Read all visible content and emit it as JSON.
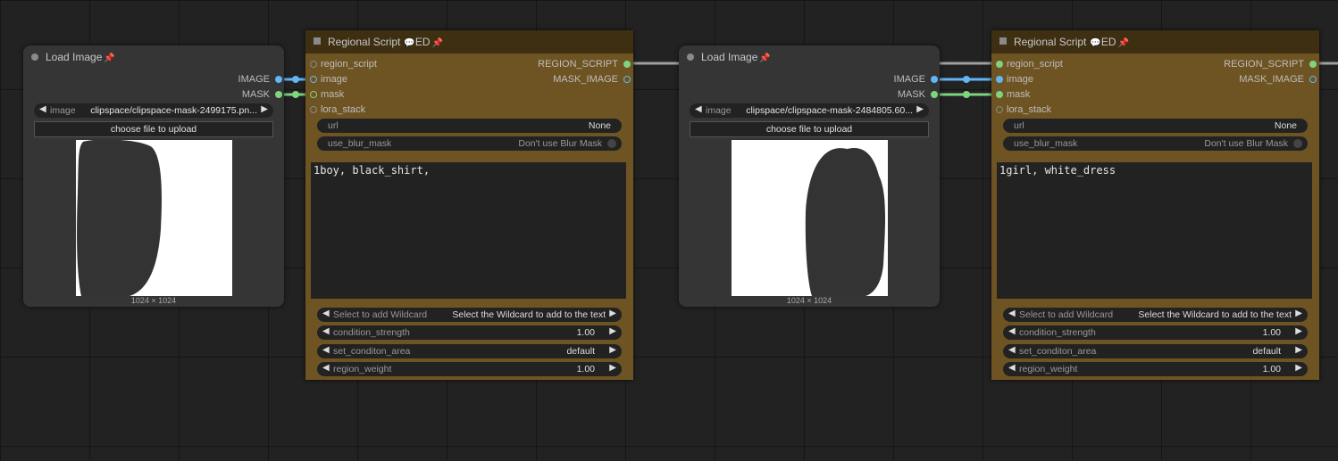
{
  "nodes": {
    "load1": {
      "title": "Load Image",
      "outputs": [
        "IMAGE",
        "MASK"
      ],
      "image_label": "image",
      "image_value": "clipspace/clipspace-mask-2499175.pn...",
      "upload_label": "choose file to upload",
      "dims": "1024 × 1024"
    },
    "reg1": {
      "title": "Regional Script",
      "tag": "ED",
      "inputs": [
        "region_script",
        "image",
        "mask",
        "lora_stack"
      ],
      "outputs": [
        "REGION_SCRIPT",
        "MASK_IMAGE"
      ],
      "url_label": "url",
      "url_value": "None",
      "blur_label": "use_blur_mask",
      "blur_value": "Don't use Blur Mask",
      "prompt": "1boy, black_shirt,",
      "wildcard_label": "Select to add Wildcard",
      "wildcard_value": "Select the Wildcard to add to the text",
      "cond_label": "condition_strength",
      "cond_value": "1.00",
      "area_label": "set_conditon_area",
      "area_value": "default",
      "weight_label": "region_weight",
      "weight_value": "1.00"
    },
    "load2": {
      "title": "Load Image",
      "outputs": [
        "IMAGE",
        "MASK"
      ],
      "image_label": "image",
      "image_value": "clipspace/clipspace-mask-2484805.60...",
      "upload_label": "choose file to upload",
      "dims": "1024 × 1024"
    },
    "reg2": {
      "title": "Regional Script",
      "tag": "ED",
      "inputs": [
        "region_script",
        "image",
        "mask",
        "lora_stack"
      ],
      "outputs": [
        "REGION_SCRIPT",
        "MASK_IMAGE"
      ],
      "url_label": "url",
      "url_value": "None",
      "blur_label": "use_blur_mask",
      "blur_value": "Don't use Blur Mask",
      "prompt": "1girl, white_dress",
      "wildcard_label": "Select to add Wildcard",
      "wildcard_value": "Select the Wildcard to add to the text",
      "cond_label": "condition_strength",
      "cond_value": "1.00",
      "area_label": "set_conditon_area",
      "area_value": "default",
      "weight_label": "region_weight",
      "weight_value": "1.00"
    }
  },
  "colors": {
    "canvas": "#222222",
    "regional_body": "#6f5423",
    "regional_title": "#3e2f12",
    "image_link": "#64b5f6",
    "mask_link": "#7fd47f",
    "script_link": "#a0a0a0"
  }
}
